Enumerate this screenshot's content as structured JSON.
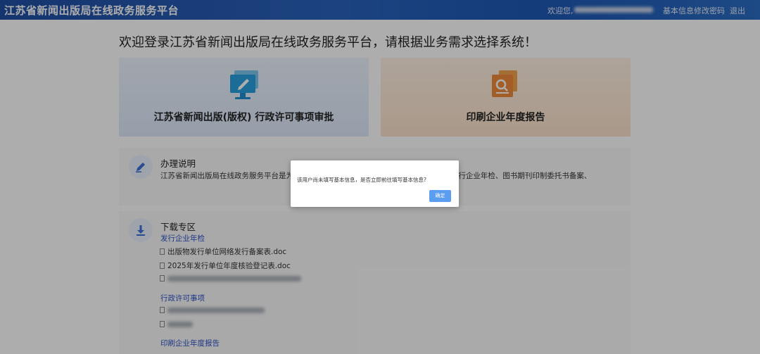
{
  "header": {
    "title": "江苏省新闻出版局在线政务服务平台",
    "welcome": "欢迎您,",
    "nav": {
      "basic_info": "基本信息",
      "change_password": "修改密码",
      "logout": "退出"
    }
  },
  "main": {
    "title": "欢迎登录江苏省新闻出版局在线政务服务平台，请根据业务需求选择系统！",
    "cards": [
      {
        "label": "江苏省新闻出版(版权) 行政许可事项审批",
        "icon": "monitor-pen-icon",
        "color": "#2aa0e0"
      },
      {
        "label": "印刷企业年度报告",
        "icon": "report-icon",
        "color": "#f08a3a"
      }
    ]
  },
  "instructions": {
    "heading": "办理说明",
    "text": "江苏省新闻出版局在线政务服务平台是为                                                                                                   务包含行政许可事项办理、印刷企业年度报告、发行企业年检、图书期刊印制委托书备案、"
  },
  "downloads": {
    "heading": "下载专区",
    "groups": [
      {
        "title": "发行企业年检",
        "files": [
          "出版物发行单位网络发行备案表.doc",
          "2025年发行单位年度核验登记表.doc",
          ""
        ]
      },
      {
        "title": "行政许可事项",
        "files": [
          "",
          ""
        ]
      },
      {
        "title": "印刷企业年度报告",
        "files": []
      }
    ]
  },
  "dialog": {
    "message": "该用户尚未填写基本信息，是否立即前往填写基本信息?",
    "ok_label": "确定"
  },
  "colors": {
    "header": "#2a63bd",
    "link": "#2b52c9",
    "ok_button": "#5b9ef1"
  }
}
